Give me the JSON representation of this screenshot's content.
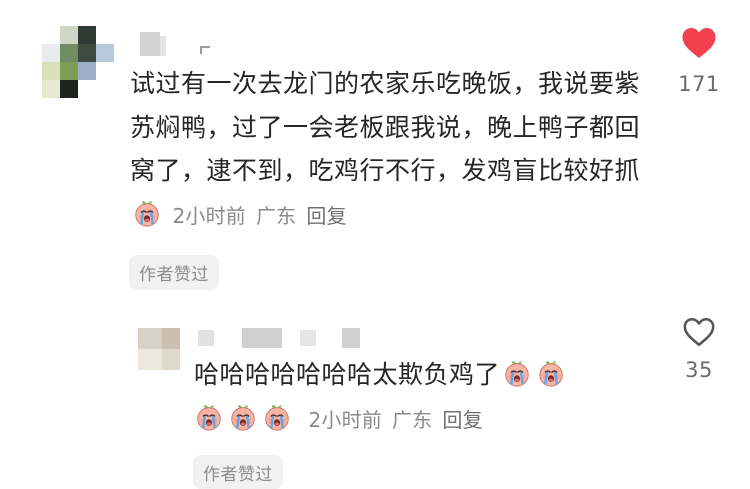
{
  "main_comment": {
    "text": "试过有一次去龙门的农家乐吃晚饭，我说要紫苏焖鸭，过了一会老板跟我说，晚上鸭子都回窝了，逮不到，吃鸡行不行，发鸡盲比较好抓",
    "time": "2小时前",
    "location": "广东",
    "reply_label": "回复",
    "author_liked_label": "作者赞过",
    "like_count": "171",
    "liked": true,
    "emoji_icons": [
      "crying-face-icon"
    ]
  },
  "reply_comment": {
    "text": "哈哈哈哈哈哈哈太欺负鸡了",
    "time": "2小时前",
    "location": "广东",
    "reply_label": "回复",
    "author_liked_label": "作者赞过",
    "like_count": "35",
    "liked": false,
    "emoji_icons": [
      "crying-face-icon",
      "crying-face-icon",
      "crying-face-icon",
      "crying-face-icon",
      "crying-face-icon"
    ]
  },
  "colors": {
    "heart_liked": "#f2404f",
    "heart_outline": "#555555",
    "meta_text": "#8a8a8a",
    "badge_bg": "#f1f1f1"
  }
}
